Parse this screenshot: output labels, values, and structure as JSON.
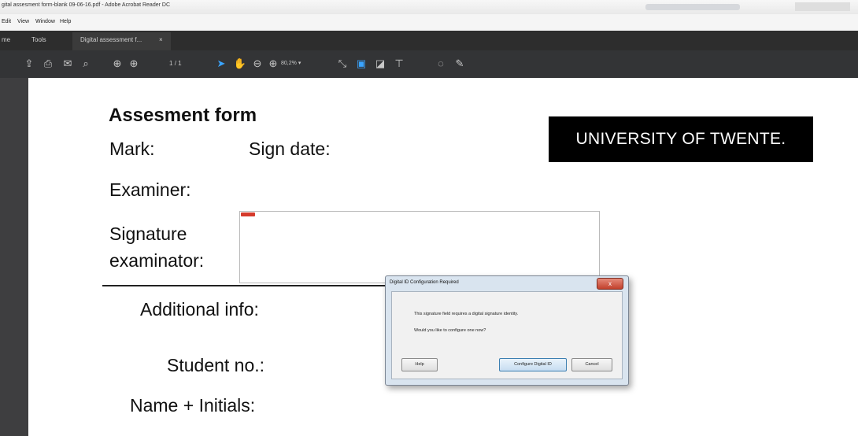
{
  "window": {
    "title": "gital assesment form-blank 09-06-16.pdf - Adobe Acrobat Reader DC"
  },
  "menu": [
    "Edit",
    "View",
    "Window",
    "Help"
  ],
  "tabs": {
    "home": "me",
    "tools": "Tools",
    "document": "Digital assessment f...",
    "close": "×"
  },
  "toolbar": {
    "page_current": "1",
    "page_total": "/ 1",
    "zoom": "80,2%",
    "zoom_caret": "▾"
  },
  "form": {
    "heading": "Assesment form",
    "mark_label": "Mark:",
    "sign_date_label": "Sign date:",
    "examiner_label": "Examiner:",
    "signature_label_line1": "Signature",
    "signature_label_line2": "examinator:",
    "additional_info_label": "Additional info:",
    "student_no_label": "Student no.:",
    "name_label": "Name + Initials:"
  },
  "logo": "UNIVERSITY OF TWENTE.",
  "dialog": {
    "title": "Digital ID Configuration Required",
    "close": "x",
    "message_line1": "This signature field requires a digital signature identity.",
    "message_line2": "Would you like to configure one now?",
    "help_button": "Help",
    "configure_button": "Configure Digital ID",
    "cancel_button": "Cancel"
  },
  "colors": {
    "toolbar": "#333436",
    "tabbar": "#2d2d2d",
    "accent_blue": "#3aa4ff",
    "logo_bg": "#000000",
    "dialog_bg": "#d9e4ef"
  }
}
